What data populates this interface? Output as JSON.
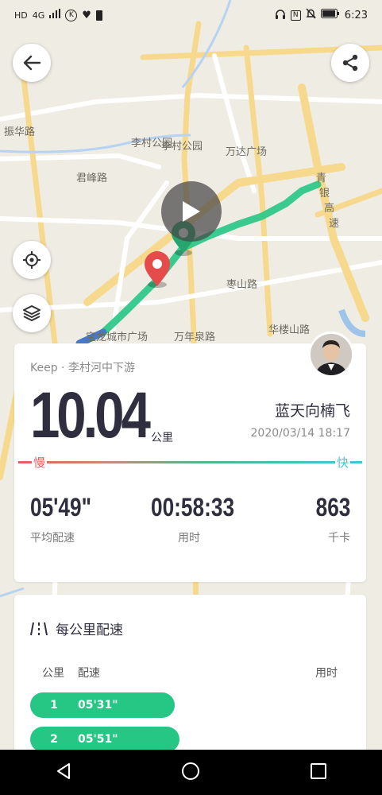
{
  "status_bar": {
    "left_badges": [
      "HD",
      "4G",
      "K"
    ],
    "time": "6:23"
  },
  "map": {
    "labels": [
      "振华路",
      "李村公园",
      "李村公园",
      "万达广场",
      "君峰路",
      "枣山路",
      "宝龙城市广场",
      "万年泉路",
      "华楼山路",
      "青",
      "银",
      "高",
      "速"
    ],
    "route_color": "#26c785",
    "start_marker_color": "#26a56e",
    "end_marker_color": "#e54b4b"
  },
  "summary": {
    "source": "Keep · 李村河中下游",
    "distance": "10.04",
    "distance_unit": "公里",
    "username": "蓝天向楠飞",
    "datetime": "2020/03/14 18:17",
    "slow_label": "慢",
    "fast_label": "快",
    "stats": [
      {
        "value": "05'49\"",
        "label": "平均配速"
      },
      {
        "value": "00:58:33",
        "label": "用时"
      },
      {
        "value": "863",
        "label": "千卡"
      }
    ]
  },
  "splits": {
    "title": "每公里配速",
    "col_km": "公里",
    "col_pace": "配速",
    "col_time": "用时",
    "rows": [
      {
        "km": "1",
        "pace": "05'31\""
      },
      {
        "km": "2",
        "pace": "05'51\""
      }
    ]
  }
}
